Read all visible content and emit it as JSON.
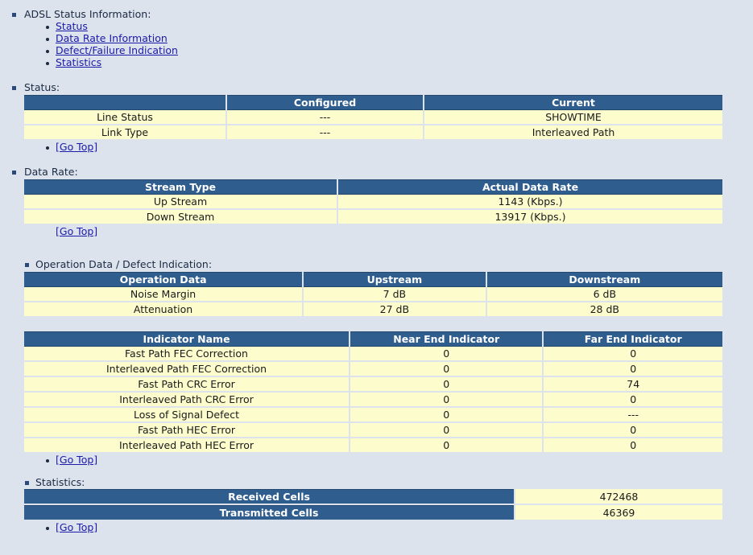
{
  "toc": {
    "title": "ADSL Status Information:",
    "links": [
      "Status",
      "Data Rate Information",
      "Defect/Failure Indication",
      "Statistics"
    ]
  },
  "status": {
    "title": "Status:",
    "headers": [
      "",
      "Configured",
      "Current"
    ],
    "rows": [
      [
        "Line Status",
        "---",
        "SHOWTIME"
      ],
      [
        "Link Type",
        "---",
        "Interleaved Path"
      ]
    ],
    "go_top": "[Go Top]"
  },
  "data_rate": {
    "title": "Data Rate:",
    "headers": [
      "Stream Type",
      "Actual Data Rate"
    ],
    "rows": [
      [
        "Up Stream",
        "1143 (Kbps.)"
      ],
      [
        "Down Stream",
        "13917 (Kbps.)"
      ]
    ],
    "go_top": "[Go Top]"
  },
  "operation": {
    "title": "Operation Data / Defect Indication:",
    "headers": [
      "Operation Data",
      "Upstream",
      "Downstream"
    ],
    "rows": [
      [
        "Noise Margin",
        "7 dB",
        "6 dB"
      ],
      [
        "Attenuation",
        "27 dB",
        "28 dB"
      ]
    ]
  },
  "indicators": {
    "headers": [
      "Indicator Name",
      "Near End Indicator",
      "Far End Indicator"
    ],
    "rows": [
      [
        "Fast Path FEC Correction",
        "0",
        "0"
      ],
      [
        "Interleaved Path FEC Correction",
        "0",
        "0"
      ],
      [
        "Fast Path CRC Error",
        "0",
        "74"
      ],
      [
        "Interleaved Path CRC Error",
        "0",
        "0"
      ],
      [
        "Loss of Signal Defect",
        "0",
        "---"
      ],
      [
        "Fast Path HEC Error",
        "0",
        "0"
      ],
      [
        "Interleaved Path HEC Error",
        "0",
        "0"
      ]
    ],
    "go_top": "[Go Top]"
  },
  "statistics": {
    "title": "Statistics:",
    "rows": [
      [
        "Received Cells",
        "472468"
      ],
      [
        "Transmitted Cells",
        "46369"
      ]
    ],
    "go_top": "[Go Top]"
  }
}
